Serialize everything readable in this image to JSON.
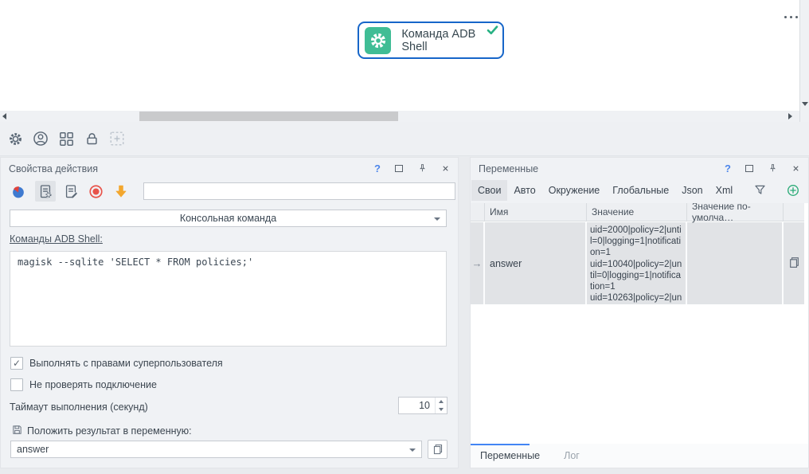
{
  "canvas": {
    "node": {
      "label": "Команда ADB Shell"
    }
  },
  "properties_panel": {
    "title": "Свойства действия",
    "help_label": "?",
    "command_type_value": "Консольная команда",
    "commands_link": "Команды ADB Shell:",
    "command_text": "magisk --sqlite 'SELECT * FROM policies;'",
    "run_as_su": {
      "label": "Выполнять с правами суперпользователя",
      "mark": "✓"
    },
    "skip_check": {
      "label": "Не проверять подключение",
      "mark": ""
    },
    "timeout_label": "Таймаут выполнения (секунд)",
    "timeout_value": "10",
    "result_label": "Положить результат в переменную:",
    "result_variable": "answer"
  },
  "variables_panel": {
    "title": "Переменные",
    "help_label": "?",
    "tabs": [
      "Свои",
      "Авто",
      "Окружение",
      "Глобальные",
      "Json",
      "Xml"
    ],
    "active_tab": "Свои",
    "table": {
      "columns": [
        "Имя",
        "Значение",
        "Значение по-умолча…"
      ],
      "rows": [
        {
          "marker": "→",
          "name": "answer",
          "value": "uid=2000|policy=2|until=0|logging=1|notification=1\nuid=10040|policy=2|until=0|logging=1|notification=1\nuid=10263|policy=2|un"
        }
      ]
    },
    "bottom_tabs": [
      "Переменные",
      "Лог"
    ],
    "active_bottom_tab": "Переменные"
  },
  "colors": {
    "node_border": "#1766c9",
    "node_icon_bg": "#40bd95",
    "check_green": "#27b183",
    "accent_blue": "#4285f4",
    "record_red": "#e8534a",
    "arrow_orange": "#f3a72e"
  }
}
